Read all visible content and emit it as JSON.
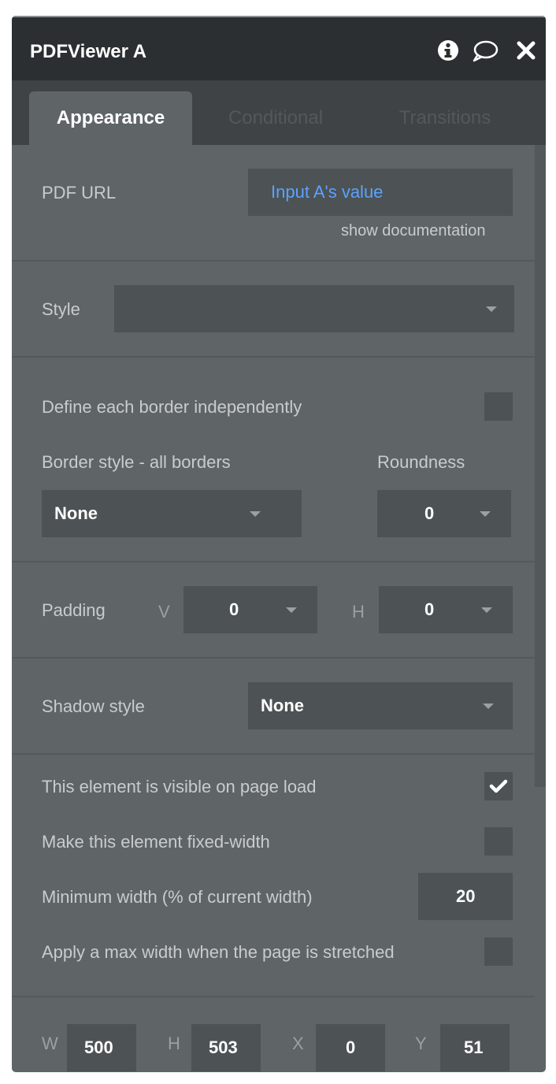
{
  "window": {
    "title": "PDFViewer A"
  },
  "tabs": [
    {
      "label": "Appearance"
    },
    {
      "label": "Conditional"
    },
    {
      "label": "Transitions"
    }
  ],
  "pdf_url": {
    "label": "PDF URL",
    "value": "Input A's value",
    "doc_link": "show documentation"
  },
  "style": {
    "label": "Style",
    "value": ""
  },
  "border": {
    "independent_label": "Define each border independently",
    "style_label": "Border style - all borders",
    "style_value": "None",
    "roundness_label": "Roundness",
    "roundness_value": "0"
  },
  "padding": {
    "label": "Padding",
    "v_label": "V",
    "v_value": "0",
    "h_label": "H",
    "h_value": "0"
  },
  "shadow": {
    "label": "Shadow style",
    "value": "None"
  },
  "visibility": {
    "visible_label": "This element is visible on page load",
    "visible_checked": true,
    "fixed_label": "Make this element fixed-width",
    "minwidth_label": "Minimum width (% of current width)",
    "minwidth_value": "20",
    "maxwidth_label": "Apply a max width when the page is stretched"
  },
  "geometry": {
    "w_label": "W",
    "w_value": "500",
    "h_label": "H",
    "h_value": "503",
    "x_label": "X",
    "x_value": "0",
    "y_label": "Y",
    "y_value": "51"
  },
  "colors": {
    "link": "#5aa3ff",
    "panel": "#5f6466",
    "titlebar": "#2b2f31"
  }
}
